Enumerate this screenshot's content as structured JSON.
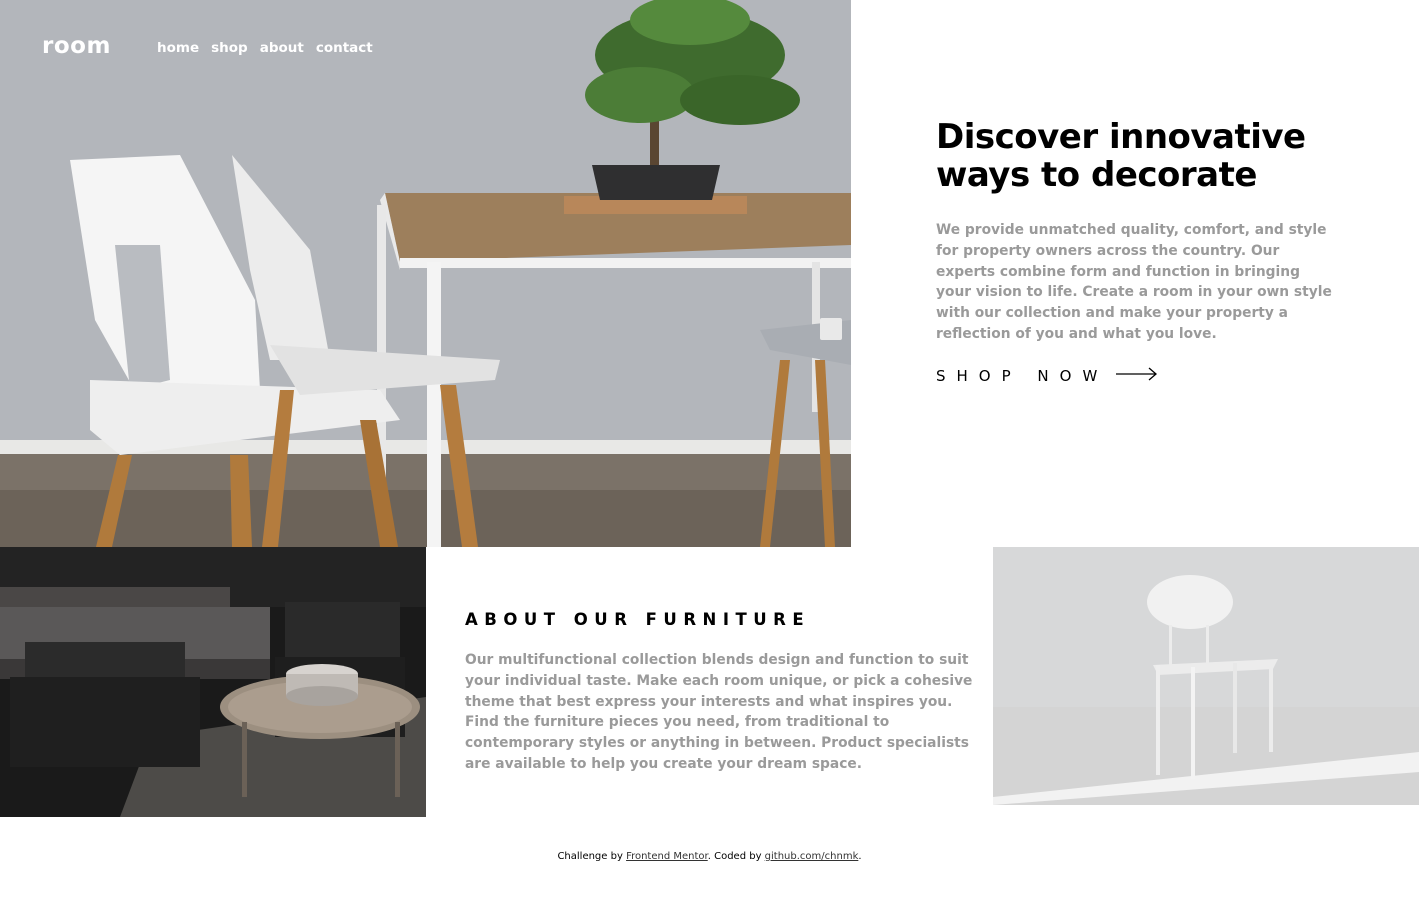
{
  "header": {
    "logo": "room",
    "nav": [
      "home",
      "shop",
      "about",
      "contact"
    ]
  },
  "hero": {
    "title_line1": "Discover innovative",
    "title_line2": "ways to decorate",
    "description": "We provide unmatched quality, comfort, and style for property owners across the country. Our experts combine form and function in bringing your vision to life. Create a room in your own style with our collection and make your property a reflection of you and what you love.",
    "cta": "SHOP NOW"
  },
  "about": {
    "title": "ABOUT OUR FURNITURE",
    "description": "Our multifunctional collection blends design and function to suit your individual taste. Make each room unique, or pick a cohesive theme that best express your interests and what inspires you. Find the furniture pieces you need, from traditional to contemporary styles or anything in between. Product specialists are available to help you create your dream space."
  },
  "footer": {
    "prefix": "Challenge by ",
    "link1": "Frontend Mentor",
    "middle": ". Coded by ",
    "link2": "github.com/chnmk",
    "suffix": "."
  }
}
